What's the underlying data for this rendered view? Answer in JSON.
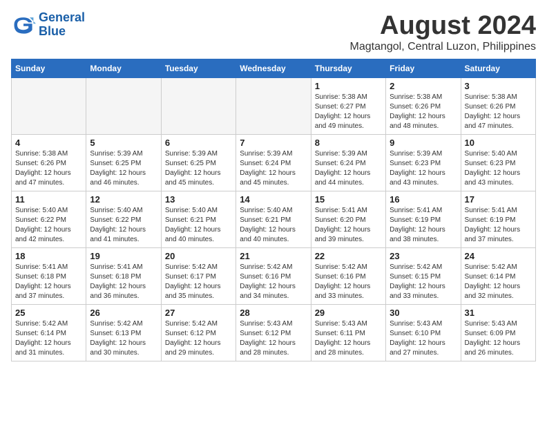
{
  "logo": {
    "line1": "General",
    "line2": "Blue"
  },
  "title": "August 2024",
  "subtitle": "Magtangol, Central Luzon, Philippines",
  "days_of_week": [
    "Sunday",
    "Monday",
    "Tuesday",
    "Wednesday",
    "Thursday",
    "Friday",
    "Saturday"
  ],
  "weeks": [
    [
      {
        "day": "",
        "info": ""
      },
      {
        "day": "",
        "info": ""
      },
      {
        "day": "",
        "info": ""
      },
      {
        "day": "",
        "info": ""
      },
      {
        "day": "1",
        "info": "Sunrise: 5:38 AM\nSunset: 6:27 PM\nDaylight: 12 hours\nand 49 minutes."
      },
      {
        "day": "2",
        "info": "Sunrise: 5:38 AM\nSunset: 6:26 PM\nDaylight: 12 hours\nand 48 minutes."
      },
      {
        "day": "3",
        "info": "Sunrise: 5:38 AM\nSunset: 6:26 PM\nDaylight: 12 hours\nand 47 minutes."
      }
    ],
    [
      {
        "day": "4",
        "info": "Sunrise: 5:38 AM\nSunset: 6:26 PM\nDaylight: 12 hours\nand 47 minutes."
      },
      {
        "day": "5",
        "info": "Sunrise: 5:39 AM\nSunset: 6:25 PM\nDaylight: 12 hours\nand 46 minutes."
      },
      {
        "day": "6",
        "info": "Sunrise: 5:39 AM\nSunset: 6:25 PM\nDaylight: 12 hours\nand 45 minutes."
      },
      {
        "day": "7",
        "info": "Sunrise: 5:39 AM\nSunset: 6:24 PM\nDaylight: 12 hours\nand 45 minutes."
      },
      {
        "day": "8",
        "info": "Sunrise: 5:39 AM\nSunset: 6:24 PM\nDaylight: 12 hours\nand 44 minutes."
      },
      {
        "day": "9",
        "info": "Sunrise: 5:39 AM\nSunset: 6:23 PM\nDaylight: 12 hours\nand 43 minutes."
      },
      {
        "day": "10",
        "info": "Sunrise: 5:40 AM\nSunset: 6:23 PM\nDaylight: 12 hours\nand 43 minutes."
      }
    ],
    [
      {
        "day": "11",
        "info": "Sunrise: 5:40 AM\nSunset: 6:22 PM\nDaylight: 12 hours\nand 42 minutes."
      },
      {
        "day": "12",
        "info": "Sunrise: 5:40 AM\nSunset: 6:22 PM\nDaylight: 12 hours\nand 41 minutes."
      },
      {
        "day": "13",
        "info": "Sunrise: 5:40 AM\nSunset: 6:21 PM\nDaylight: 12 hours\nand 40 minutes."
      },
      {
        "day": "14",
        "info": "Sunrise: 5:40 AM\nSunset: 6:21 PM\nDaylight: 12 hours\nand 40 minutes."
      },
      {
        "day": "15",
        "info": "Sunrise: 5:41 AM\nSunset: 6:20 PM\nDaylight: 12 hours\nand 39 minutes."
      },
      {
        "day": "16",
        "info": "Sunrise: 5:41 AM\nSunset: 6:19 PM\nDaylight: 12 hours\nand 38 minutes."
      },
      {
        "day": "17",
        "info": "Sunrise: 5:41 AM\nSunset: 6:19 PM\nDaylight: 12 hours\nand 37 minutes."
      }
    ],
    [
      {
        "day": "18",
        "info": "Sunrise: 5:41 AM\nSunset: 6:18 PM\nDaylight: 12 hours\nand 37 minutes."
      },
      {
        "day": "19",
        "info": "Sunrise: 5:41 AM\nSunset: 6:18 PM\nDaylight: 12 hours\nand 36 minutes."
      },
      {
        "day": "20",
        "info": "Sunrise: 5:42 AM\nSunset: 6:17 PM\nDaylight: 12 hours\nand 35 minutes."
      },
      {
        "day": "21",
        "info": "Sunrise: 5:42 AM\nSunset: 6:16 PM\nDaylight: 12 hours\nand 34 minutes."
      },
      {
        "day": "22",
        "info": "Sunrise: 5:42 AM\nSunset: 6:16 PM\nDaylight: 12 hours\nand 33 minutes."
      },
      {
        "day": "23",
        "info": "Sunrise: 5:42 AM\nSunset: 6:15 PM\nDaylight: 12 hours\nand 33 minutes."
      },
      {
        "day": "24",
        "info": "Sunrise: 5:42 AM\nSunset: 6:14 PM\nDaylight: 12 hours\nand 32 minutes."
      }
    ],
    [
      {
        "day": "25",
        "info": "Sunrise: 5:42 AM\nSunset: 6:14 PM\nDaylight: 12 hours\nand 31 minutes."
      },
      {
        "day": "26",
        "info": "Sunrise: 5:42 AM\nSunset: 6:13 PM\nDaylight: 12 hours\nand 30 minutes."
      },
      {
        "day": "27",
        "info": "Sunrise: 5:42 AM\nSunset: 6:12 PM\nDaylight: 12 hours\nand 29 minutes."
      },
      {
        "day": "28",
        "info": "Sunrise: 5:43 AM\nSunset: 6:12 PM\nDaylight: 12 hours\nand 28 minutes."
      },
      {
        "day": "29",
        "info": "Sunrise: 5:43 AM\nSunset: 6:11 PM\nDaylight: 12 hours\nand 28 minutes."
      },
      {
        "day": "30",
        "info": "Sunrise: 5:43 AM\nSunset: 6:10 PM\nDaylight: 12 hours\nand 27 minutes."
      },
      {
        "day": "31",
        "info": "Sunrise: 5:43 AM\nSunset: 6:09 PM\nDaylight: 12 hours\nand 26 minutes."
      }
    ]
  ]
}
